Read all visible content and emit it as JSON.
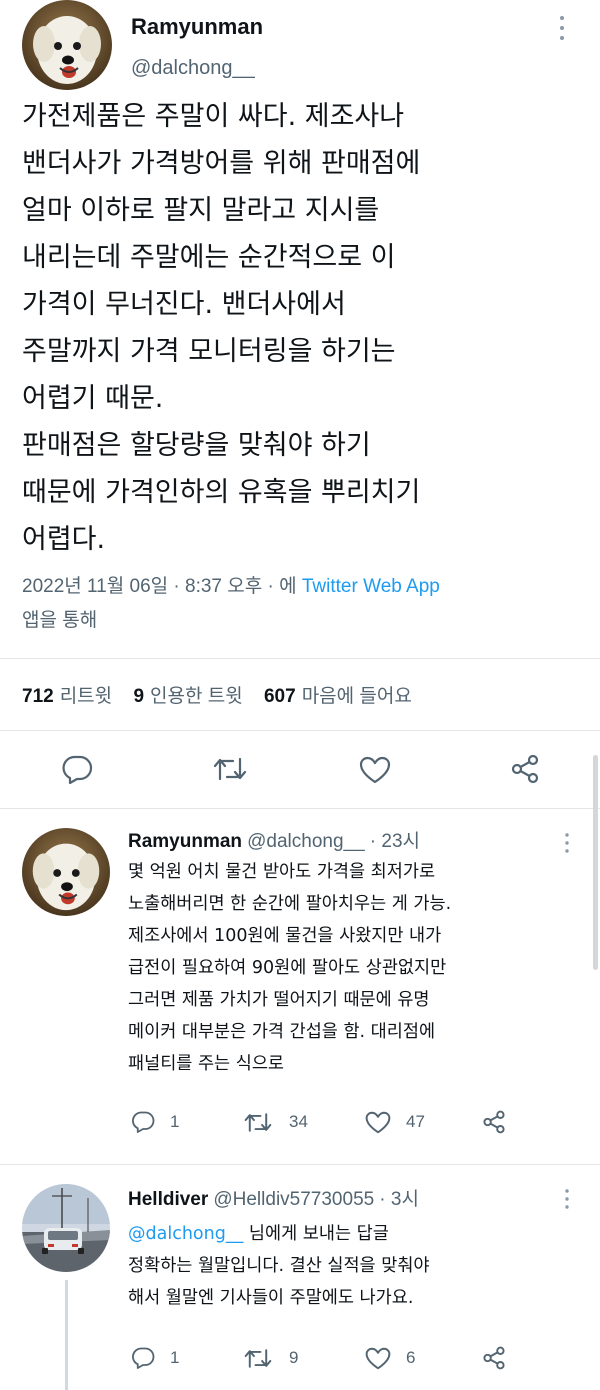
{
  "main_tweet": {
    "author_name": "Ramyunman",
    "author_handle": "@dalchong__",
    "text_lines": [
      "가전제품은 주말이 싸다. 제조사나",
      "밴더사가 가격방어를 위해 판매점에",
      "얼마 이하로 팔지 말라고 지시를",
      "내리는데 주말에는 순간적으로 이",
      "가격이 무너진다. 밴더사에서",
      "주말까지 가격 모니터링을 하기는",
      "어렵기 때문.",
      "판매점은 할당량을 맞춰야 하기",
      "때문에 가격인하의 유혹을 뿌리치기",
      "어렵다."
    ],
    "timestamp": "2022년 11월 06일 · 8:37 오후 · 에 ",
    "client": "Twitter Web App",
    "client_suffix": "앱을 통해",
    "stats": {
      "retweets_count": "712",
      "retweets_label": "리트윗",
      "quotes_count": "9",
      "quotes_label": "인용한 트윗",
      "likes_count": "607",
      "likes_label": "마음에 들어요"
    }
  },
  "icons": {
    "reply": "reply-icon",
    "retweet": "retweet-icon",
    "like": "heart-icon",
    "share": "share-icon",
    "more": "more-icon"
  },
  "replies": [
    {
      "author_name": "Ramyunman",
      "author_handle": "@dalchong__",
      "time": "· 23시",
      "replying_to": "",
      "replying_suffix": "",
      "text_lines": [
        "몇 억원 어치 물건 받아도 가격을 최저가로",
        "노출해버리면 한 순간에 팔아치우는 게 가능.",
        "제조사에서 100원에 물건을 사왔지만 내가",
        "급전이 필요하여 90원에 팔아도 상관없지만",
        "그러면 제품 가치가 떨어지기 때문에 유명",
        "메이커 대부분은 가격 간섭을 함. 대리점에",
        "패널티를 주는 식으로"
      ],
      "reply_count": "1",
      "retweet_count": "34",
      "like_count": "47"
    },
    {
      "author_name": "Helldiver",
      "author_handle": "@Helldiv57730055",
      "time": "· 3시",
      "replying_to": "@dalchong__",
      "replying_suffix": " 님에게 보내는 답글",
      "text_lines": [
        "정확하는 월말입니다. 결산 실적을 맞춰야",
        "해서 월말엔 기사들이 주말에도 나가요."
      ],
      "reply_count": "1",
      "retweet_count": "9",
      "like_count": "6"
    }
  ],
  "colors": {
    "text": "#0f1419",
    "secondary": "#536471",
    "link": "#1d9bf0",
    "divider": "#e3e6e8"
  }
}
